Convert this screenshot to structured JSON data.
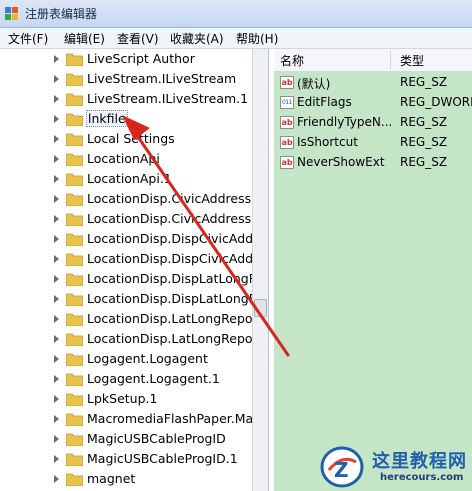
{
  "window": {
    "title": "注册表编辑器",
    "icon": "regedit-icon"
  },
  "menu": [
    "文件(F)",
    "编辑(E)",
    "查看(V)",
    "收藏夹(A)",
    "帮助(H)"
  ],
  "tree": {
    "items": [
      "LiveScript Author",
      "LiveStream.ILiveStream",
      "LiveStream.ILiveStream.1",
      "lnkfile",
      "Local Settings",
      "LocationApi",
      "LocationApi.1",
      "LocationDisp.CivicAddressRe",
      "LocationDisp.CivicAddressRe",
      "LocationDisp.DispCivicAddre",
      "LocationDisp.DispCivicAddre",
      "LocationDisp.DispLatLongRe",
      "LocationDisp.DispLatLongRe",
      "LocationDisp.LatLongReport",
      "LocationDisp.LatLongReport",
      "Logagent.Logagent",
      "Logagent.Logagent.1",
      "LpkSetup.1",
      "MacromediaFlashPaper.Mac",
      "MagicUSBCableProgID",
      "MagicUSBCableProgID.1",
      "magnet"
    ],
    "selected": "lnkfile"
  },
  "values": {
    "headers": {
      "name": "名称",
      "type": "类型"
    },
    "rows": [
      {
        "name": "(默认)",
        "type": "REG_SZ",
        "icon": "ab"
      },
      {
        "name": "EditFlags",
        "type": "REG_DWORD",
        "icon": "bin"
      },
      {
        "name": "FriendlyTypeN...",
        "type": "REG_SZ",
        "icon": "ab"
      },
      {
        "name": "IsShortcut",
        "type": "REG_SZ",
        "icon": "ab"
      },
      {
        "name": "NeverShowExt",
        "type": "REG_SZ",
        "icon": "ab"
      }
    ],
    "background": "#c4e5c6"
  },
  "watermark": {
    "text": "这里教程网",
    "url": "herecours.com"
  },
  "colors": {
    "arrow": "#d9261c",
    "selection": "#6a8fc6"
  }
}
